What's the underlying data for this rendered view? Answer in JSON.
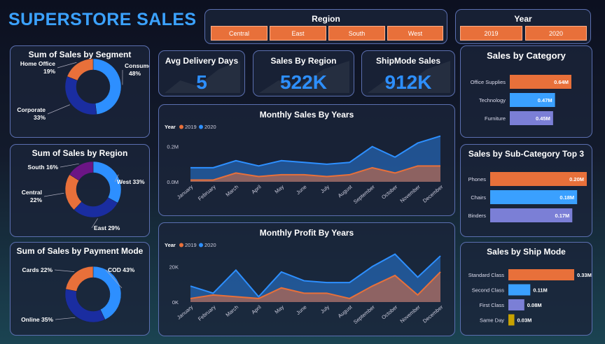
{
  "title": "SUPERSTORE SALES",
  "region_slicer": {
    "title": "Region",
    "options": [
      "Central",
      "East",
      "South",
      "West"
    ]
  },
  "year_slicer": {
    "title": "Year",
    "options": [
      "2019",
      "2020"
    ]
  },
  "kpis": [
    {
      "label": "Avg Delivery Days",
      "value": "5"
    },
    {
      "label": "Sales By Region",
      "value": "522K"
    },
    {
      "label": "ShipMode Sales",
      "value": "912K"
    }
  ],
  "colors": {
    "orange": "#e8703a",
    "blue": "#2d8fff",
    "navy": "#1a2da0",
    "purple": "#6b1585",
    "lightblue": "#3aa0ff",
    "lavender": "#7b7fd6",
    "gold": "#c8a200",
    "title": "#3ba2ff"
  },
  "chart_data": [
    {
      "id": "segment",
      "type": "pie",
      "title": "Sum of Sales by Segment",
      "categories": [
        "Consumer",
        "Corporate",
        "Home Office"
      ],
      "values": [
        48,
        33,
        19
      ],
      "labels": [
        "48%",
        "33%",
        "19%"
      ],
      "colors": [
        "#2d8fff",
        "#1a2da0",
        "#e8703a"
      ]
    },
    {
      "id": "region",
      "type": "pie",
      "title": "Sum of Sales by Region",
      "categories": [
        "West",
        "East",
        "Central",
        "South"
      ],
      "values": [
        33,
        29,
        22,
        16
      ],
      "labels": [
        "33%",
        "29%",
        "22%",
        "16%"
      ],
      "colors": [
        "#2d8fff",
        "#1a2da0",
        "#e8703a",
        "#6b1585"
      ]
    },
    {
      "id": "payment",
      "type": "pie",
      "title": "Sum of Sales by Payment Mode",
      "categories": [
        "COD",
        "Online",
        "Cards"
      ],
      "values": [
        43,
        35,
        22
      ],
      "labels": [
        "43%",
        "35%",
        "22%"
      ],
      "colors": [
        "#2d8fff",
        "#1a2da0",
        "#e8703a"
      ]
    },
    {
      "id": "monthly_sales",
      "type": "area",
      "title": "Monthly Sales By Years",
      "legend_title": "Year",
      "legend_position": "top-left",
      "categories": [
        "January",
        "February",
        "March",
        "April",
        "May",
        "June",
        "July",
        "August",
        "September",
        "October",
        "November",
        "December"
      ],
      "series": [
        {
          "name": "2019",
          "color": "#e8703a",
          "values": [
            0.01,
            0.01,
            0.05,
            0.03,
            0.04,
            0.04,
            0.03,
            0.04,
            0.08,
            0.05,
            0.09,
            0.09
          ]
        },
        {
          "name": "2020",
          "color": "#2d8fff",
          "values": [
            0.08,
            0.08,
            0.12,
            0.09,
            0.12,
            0.11,
            0.1,
            0.11,
            0.2,
            0.14,
            0.22,
            0.26
          ]
        }
      ],
      "yticks": [
        "0.0M",
        "0.2M"
      ],
      "ytick_values": [
        0,
        0.2
      ],
      "ylim": [
        0,
        0.27
      ]
    },
    {
      "id": "monthly_profit",
      "type": "area",
      "title": "Monthly Profit By Years",
      "legend_title": "Year",
      "legend_position": "top-left",
      "categories": [
        "January",
        "February",
        "March",
        "April",
        "May",
        "June",
        "July",
        "August",
        "September",
        "October",
        "November",
        "December"
      ],
      "series": [
        {
          "name": "2019",
          "color": "#e8703a",
          "values": [
            2000,
            4000,
            3000,
            2000,
            8000,
            5000,
            5000,
            2000,
            9000,
            15000,
            4000,
            17000
          ]
        },
        {
          "name": "2020",
          "color": "#2d8fff",
          "values": [
            9000,
            5000,
            18000,
            3000,
            17000,
            12000,
            11000,
            11000,
            20000,
            27000,
            14000,
            26000
          ]
        }
      ],
      "yticks": [
        "0K",
        "20K"
      ],
      "ytick_values": [
        0,
        20000
      ],
      "ylim": [
        0,
        28000
      ]
    },
    {
      "id": "category",
      "type": "bar",
      "title": "Sales by Category",
      "categories": [
        "Office Supplies",
        "Technology",
        "Furniture"
      ],
      "values": [
        0.64,
        0.47,
        0.45
      ],
      "labels": [
        "0.64M",
        "0.47M",
        "0.45M"
      ],
      "colors": [
        "#e8703a",
        "#3aa0ff",
        "#7b7fd6"
      ]
    },
    {
      "id": "subcategory",
      "type": "bar",
      "title": "Sales by Sub-Category Top 3",
      "categories": [
        "Phones",
        "Chairs",
        "Binders"
      ],
      "values": [
        0.2,
        0.18,
        0.17
      ],
      "labels": [
        "0.20M",
        "0.18M",
        "0.17M"
      ],
      "colors": [
        "#e8703a",
        "#3aa0ff",
        "#7b7fd6"
      ]
    },
    {
      "id": "shipmode",
      "type": "bar",
      "title": "Sales by Ship Mode",
      "categories": [
        "Standard Class",
        "Second Class",
        "First Class",
        "Same Day"
      ],
      "values": [
        0.33,
        0.11,
        0.08,
        0.03
      ],
      "labels": [
        "0.33M",
        "0.11M",
        "0.08M",
        "0.03M"
      ],
      "colors": [
        "#e8703a",
        "#3aa0ff",
        "#7b7fd6",
        "#c8a200"
      ]
    }
  ]
}
